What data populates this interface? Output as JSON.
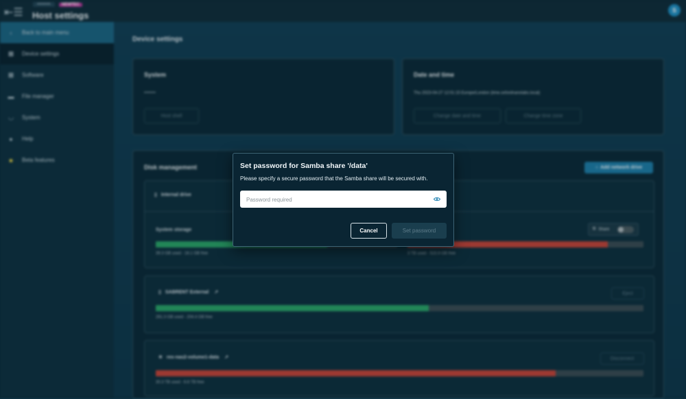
{
  "header": {
    "hostname": "••••••••",
    "badge": "NEWTEC",
    "title": "Host settings",
    "avatar_initial": "S"
  },
  "sidebar": {
    "items": [
      {
        "label": "Back to main menu",
        "icon": "chevron-left-icon"
      },
      {
        "label": "Device settings",
        "icon": "grid-icon"
      },
      {
        "label": "Software",
        "icon": "apps-icon"
      },
      {
        "label": "File manager",
        "icon": "folder-icon"
      },
      {
        "label": "System",
        "icon": "gauge-icon"
      },
      {
        "label": "Help",
        "icon": "help-icon"
      },
      {
        "label": "Beta features",
        "icon": "beta-icon"
      }
    ]
  },
  "main": {
    "page_title": "Device settings",
    "system_card": {
      "title": "System",
      "hostname_value": "••••••••",
      "button": "Host shell"
    },
    "datetime_card": {
      "title": "Date and time",
      "value": "Thu 2023-04-27 12:01:15 Europe/London (time.oxfordnanolabs.local)",
      "button_date": "Change date and time",
      "button_zone": "Change time zone"
    },
    "disk_card": {
      "title": "Disk management",
      "add_button": "Add network drive",
      "internal": {
        "label": "Internal drive",
        "system_storage_label": "System storage",
        "share_label": "Share",
        "system_used_text": "39.3 GB used - 16.1 GB free",
        "system_used_fraction": 0.71,
        "data_used_text": "3 TB used - 515.9 GB free",
        "data_used_fraction": 0.85
      },
      "external": {
        "label": "SABRENT External",
        "button": "Eject",
        "used_text": "261.3 GB used - 204.4 GB free",
        "used_fraction": 0.56
      },
      "network": {
        "label": "rex-nas2-volume1-data",
        "button": "Disconnect",
        "used_text": "30.3 TB used - 6.6 TB free",
        "used_fraction": 0.82
      }
    }
  },
  "dialog": {
    "title": "Set password for Samba share '/data'",
    "description": "Please specify a secure password that the Samba share will be secured with.",
    "password_placeholder": "Password required",
    "cancel_label": "Cancel",
    "submit_label": "Set password",
    "accent_color": "#1e7ea9"
  }
}
